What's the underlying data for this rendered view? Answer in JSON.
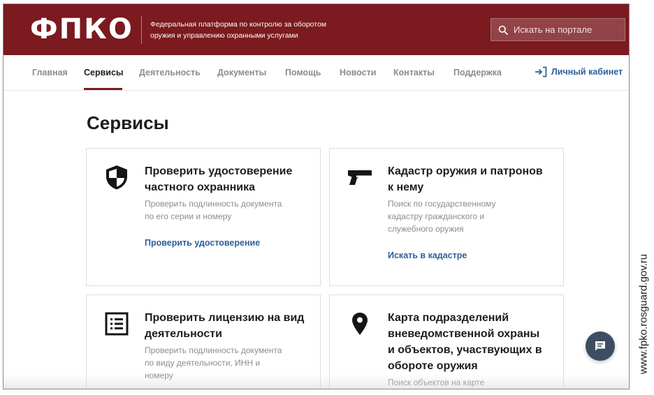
{
  "header": {
    "logo": "ФПКО",
    "tagline_line1": "Федеральная платформа по контролю за оборотом",
    "tagline_line2": "оружия и управлению охранными услугами",
    "search_placeholder": "Искать на портале",
    "brand_color": "#7b1a1f"
  },
  "nav": {
    "items": [
      {
        "label": "Главная"
      },
      {
        "label": "Сервисы",
        "active": true
      },
      {
        "label": "Деятельность"
      },
      {
        "label": "Документы"
      },
      {
        "label": "Помощь"
      },
      {
        "label": "Новости"
      },
      {
        "label": "Контакты"
      },
      {
        "label": "Поддержка"
      }
    ],
    "cabinet_label": "Личный кабинет",
    "cabinet_icon": "login-icon"
  },
  "main": {
    "title": "Сервисы",
    "cards": [
      {
        "icon": "shield-icon",
        "title_lines": [
          "Проверить удостоверение",
          "частного охранника"
        ],
        "desc_lines": [
          "Проверить подлинность документа",
          "по его серии и номеру"
        ],
        "link": "Проверить удостоверение"
      },
      {
        "icon": "pistol-icon",
        "title_lines": [
          "Кадастр оружия и патронов",
          "к нему"
        ],
        "desc_lines": [
          "Поиск по государственному",
          "кадастру гражданского и",
          "служебного оружия"
        ],
        "link": "Искать в кадастре"
      },
      {
        "icon": "list-document-icon",
        "title_lines": [
          "Проверить лицензию на вид",
          "деятельности"
        ],
        "desc_lines": [
          "Проверить подлинность документа",
          "по виду деятельности, ИНН и",
          "номеру"
        ]
      },
      {
        "icon": "map-pin-icon",
        "title_lines": [
          "Карта подразделений",
          "вневедомственной охраны",
          "и объектов, участвующих в",
          "обороте оружия"
        ],
        "desc_lines": [
          "Поиск объектов на карте"
        ]
      }
    ]
  },
  "chat_icon": "chat-icon",
  "link_color": "#2d5f9e",
  "caption": "www.fpko.rosguard.gov.ru"
}
